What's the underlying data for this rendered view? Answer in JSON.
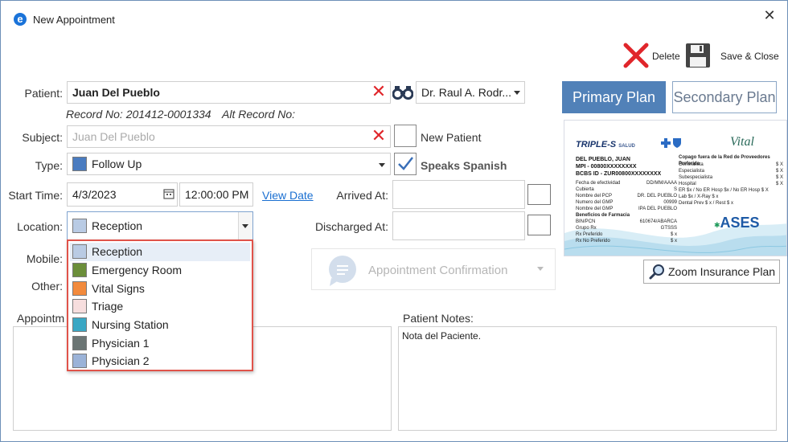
{
  "window": {
    "title": "New Appointment",
    "icon": "edge-e-icon"
  },
  "toolbar": {
    "delete_label": "Delete",
    "save_close_label": "Save & Close"
  },
  "patient": {
    "label": "Patient:",
    "value": "Juan Del Pueblo",
    "record_no": "Record No: 201412-0001334",
    "alt_record_no": "Alt Record No:",
    "doctor": "Dr. Raul A. Rodr..."
  },
  "subject": {
    "label": "Subject:",
    "placeholder": "Juan Del Pueblo",
    "new_patient_label": "New Patient"
  },
  "type": {
    "label": "Type:",
    "value": "Follow Up",
    "color": "#4a7cc0",
    "speaks_spanish_label": "Speaks Spanish"
  },
  "start_time": {
    "label": "Start Time:",
    "date": "4/3/2023",
    "time": "12:00:00 PM",
    "view_date_label": "View Date",
    "arrived_label": "Arrived At:"
  },
  "location": {
    "label": "Location:",
    "value": "Reception",
    "color": "#b9cbe4",
    "discharged_label": "Discharged At:"
  },
  "mobile": {
    "label": "Mobile:"
  },
  "other": {
    "label": "Other:"
  },
  "appointment_confirmation": {
    "label": "Appointment Confirmation"
  },
  "location_options": [
    {
      "label": "Reception",
      "color": "#b9cbe4"
    },
    {
      "label": "Emergency Room",
      "color": "#6b8e3a"
    },
    {
      "label": "Vital Signs",
      "color": "#f28a3c"
    },
    {
      "label": "Triage",
      "color": "#f7dede"
    },
    {
      "label": "Nursing Station",
      "color": "#3aa7c4"
    },
    {
      "label": "Physician 1",
      "color": "#6b7574"
    },
    {
      "label": "Physician 2",
      "color": "#9bb3d8"
    }
  ],
  "plans": {
    "primary_label": "Primary Plan",
    "secondary_label": "Secondary Plan"
  },
  "insurance_card": {
    "brand": "TRIPLE-S",
    "brand_suffix": "SALUD",
    "vital_logo": "Vital",
    "ases_logo": "ASES",
    "name": "DEL PUEBLO, JUAN",
    "mpi": "MPI - 00800XXXXXXXX",
    "bcbs": "BCBS ID - ZUR00800XXXXXXXX",
    "left_rows": [
      [
        "Fecha de efectividad",
        "DD/MM/AAAA"
      ],
      [
        "Cubierta",
        "S"
      ],
      [
        "Nombre del PCP",
        "DR. DEL PUEBLO"
      ],
      [
        "Numero del GMP",
        "00999"
      ],
      [
        "Nombre del GMP",
        "IPA DEL PUEBLO"
      ],
      [
        "Beneficios de Farmacia",
        ""
      ],
      [
        "BIN/PCN",
        "610674/ABARCA"
      ],
      [
        "Grupo Rx",
        "GTSSS"
      ],
      [
        "Rx Preferido",
        "$ x"
      ],
      [
        "Rx No Preferido",
        "$ x"
      ]
    ],
    "right_header": "Copago fuera de la Red de Proveedores Preferida",
    "right_rows": [
      [
        "Generalista",
        "$ X"
      ],
      [
        "Especialista",
        "$ X"
      ],
      [
        "Subespecialista",
        "$ X"
      ],
      [
        "Hospital",
        "$ X"
      ],
      [
        "ER $x / No ER Hosp $x / No ER Hosp $ X",
        ""
      ],
      [
        "Lab $x / X-Ray $ x",
        ""
      ],
      [
        "Dental Prev $ x / Rest $ x",
        ""
      ]
    ]
  },
  "zoom_insurance_label": "Zoom Insurance Plan",
  "appointment_notes": {
    "label": "Appointm"
  },
  "patient_notes": {
    "label": "Patient Notes:",
    "value": "Nota del Paciente."
  }
}
